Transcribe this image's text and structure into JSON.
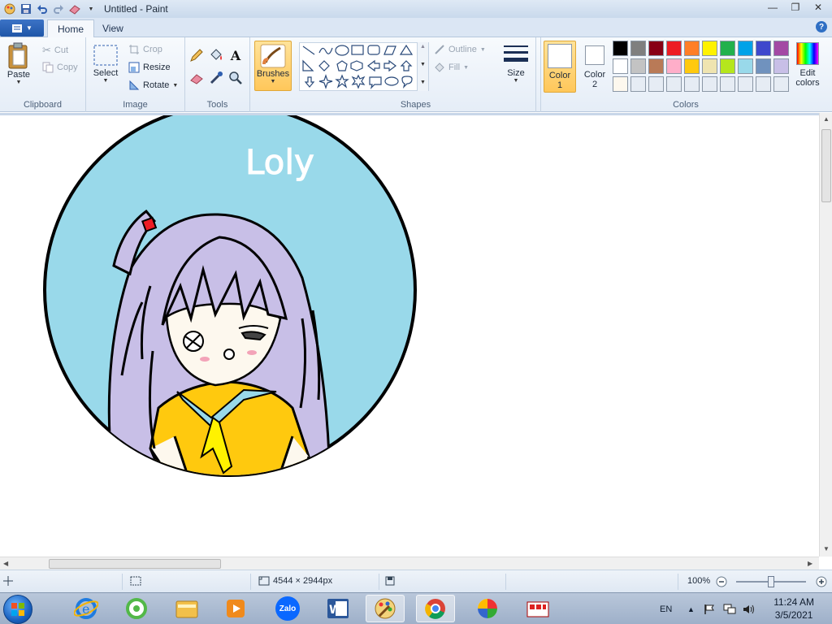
{
  "window": {
    "title": "Untitled - Paint"
  },
  "tabs": [
    {
      "label": "Home"
    },
    {
      "label": "View"
    }
  ],
  "ribbon": {
    "clipboard": {
      "label": "Clipboard",
      "paste": "Paste",
      "cut": "Cut",
      "copy": "Copy"
    },
    "image": {
      "label": "Image",
      "select": "Select",
      "crop": "Crop",
      "resize": "Resize",
      "rotate": "Rotate"
    },
    "tools": {
      "label": "Tools"
    },
    "brushes": {
      "label": "Brushes"
    },
    "shapes": {
      "label": "Shapes",
      "outline": "Outline",
      "fill": "Fill"
    },
    "size": {
      "label": "Size"
    },
    "colors": {
      "label": "Colors",
      "color1": "Color 1",
      "color2": "Color 2",
      "edit": "Edit colors",
      "palette_row1": [
        "#000000",
        "#7f7f7f",
        "#880015",
        "#ed1c24",
        "#ff7f27",
        "#fff200",
        "#22b14c",
        "#00a2e8",
        "#3f48cc",
        "#a349a4"
      ],
      "palette_row2": [
        "#ffffff",
        "#c3c3c3",
        "#b97a57",
        "#ffaec9",
        "#ffc90e",
        "#efe4b0",
        "#b5e61d",
        "#99d9ea",
        "#7092be",
        "#c8bfe7"
      ],
      "palette_row3": [
        "#fdf8ee",
        "#e6ecf4",
        "#e6ecf4",
        "#e6ecf4",
        "#e6ecf4",
        "#e6ecf4",
        "#e6ecf4",
        "#e6ecf4",
        "#e6ecf4",
        "#e6ecf4"
      ]
    }
  },
  "canvas": {
    "drawing_text": "Loly",
    "circle_color": "#99d9ea",
    "hair_color": "#c8bfe7",
    "shirt_color": "#ffc90e"
  },
  "status": {
    "image_size": "4544 × 2944px",
    "zoom": "100%"
  },
  "taskbar": {
    "apps": [
      "internet-explorer",
      "coccoc",
      "file-explorer",
      "media-player",
      "zalo",
      "word",
      "paint",
      "chrome",
      "color-app",
      "unikey"
    ],
    "zalo_label": "Zalo",
    "language": "EN",
    "time": "11:24 AM",
    "date": "3/5/2021"
  }
}
